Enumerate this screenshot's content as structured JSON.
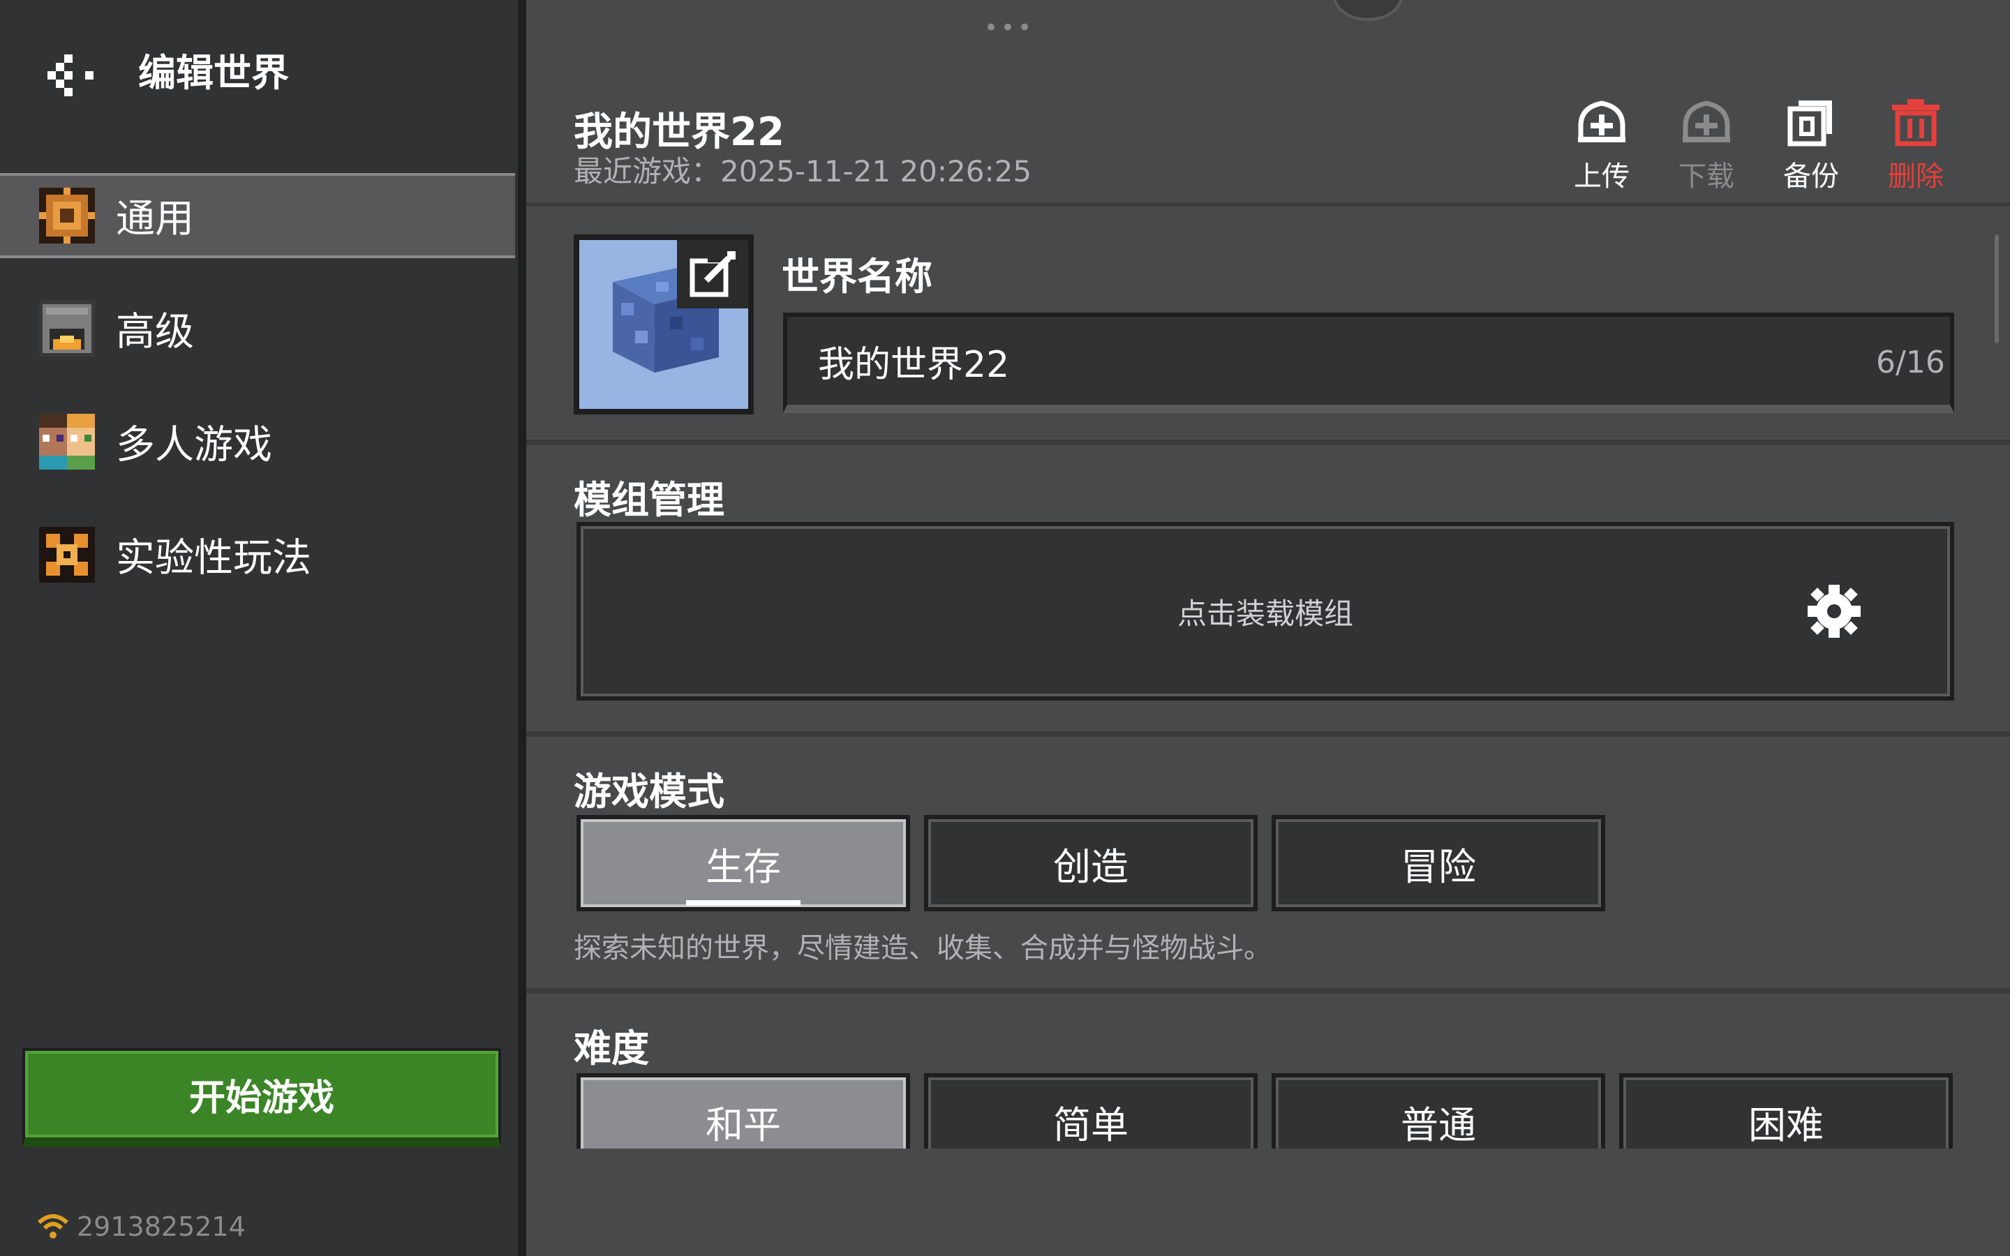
{
  "sidebar": {
    "title": "编辑世界",
    "items": [
      {
        "label": "通用",
        "icon": "gear-block-icon",
        "active": true
      },
      {
        "label": "高级",
        "icon": "furnace-icon",
        "active": false
      },
      {
        "label": "多人游戏",
        "icon": "players-icon",
        "active": false
      },
      {
        "label": "实验性玩法",
        "icon": "experiment-icon",
        "active": false
      }
    ],
    "start_button": "开始游戏",
    "network_id": "2913825214"
  },
  "header": {
    "world_title": "我的世界22",
    "last_played": "最近游戏：2025-11-21 20:26:25",
    "actions": [
      {
        "label": "上传",
        "icon": "upload-icon",
        "enabled": true
      },
      {
        "label": "下载",
        "icon": "download-icon",
        "enabled": false
      },
      {
        "label": "备份",
        "icon": "backup-icon",
        "enabled": true
      },
      {
        "label": "删除",
        "icon": "delete-icon",
        "enabled": true
      }
    ]
  },
  "world_name": {
    "label": "世界名称",
    "value": "我的世界22",
    "count": "6/16"
  },
  "mods": {
    "label": "模组管理",
    "button_text": "点击装载模组"
  },
  "game_mode": {
    "label": "游戏模式",
    "options": [
      "生存",
      "创造",
      "冒险"
    ],
    "selected": "生存",
    "description": "探索未知的世界，尽情建造、收集、合成并与怪物战斗。"
  },
  "difficulty": {
    "label": "难度",
    "options": [
      "和平",
      "简单",
      "普通",
      "困难"
    ],
    "selected": "和平"
  },
  "colors": {
    "accent_green": "#3c8527",
    "delete_red": "#e5403b",
    "disabled_gray": "#8b8b8b"
  }
}
